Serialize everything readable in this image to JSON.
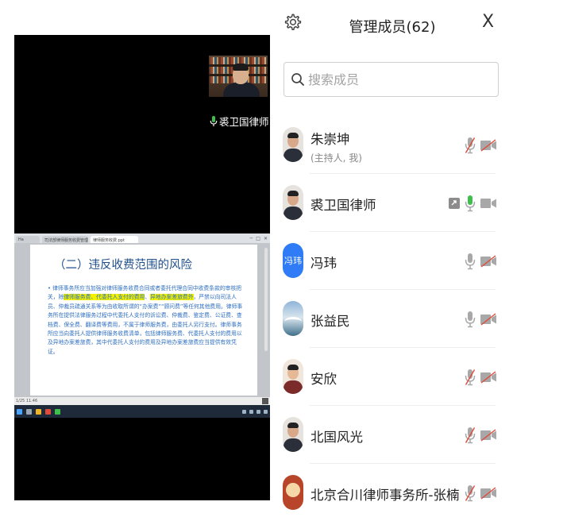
{
  "video": {
    "speaker_label": "裘卫国律师"
  },
  "shared_screen": {
    "browser_tabs": [
      "Ha",
      "司法部律师服务收费管理办法.ppt",
      "律师服务收费.ppt"
    ],
    "slide_title": "（二）违反收费范围的风险",
    "slide_body": {
      "p1": "律师事务所应当加强对律师服务收费合同或者委托代理合同中收费条款的审核把关，除",
      "h1": "律师服务费、代委托人支付的费用",
      "p2": "、",
      "h2": "异地办案差旅费外",
      "p3": "，严禁以向司法人员、仲裁员疏通关系等为由收取所谓的“办案费”“顾问费”等任何其他费用。律师事务所在提供法律服务过程中代委托人支付的诉讼费、仲裁费、鉴定费、公证费、查档费、保全费、翻译费等费用，不属于律师服务费，由委托人另行支付。律师事务所应当向委托人提供律师服务收费清单，包括律师服务费、代委托人支付的费用以及异地办案差旅费，其中代委托人支付的费用及异地办案差旅费应当提供有效凭证。"
    },
    "status_text": "1/25  11.46"
  },
  "panel": {
    "title": "管理成员(62)",
    "close_label": "X",
    "search_placeholder": "搜索成员"
  },
  "members": [
    {
      "name": "朱崇坤",
      "sub": "(主持人, 我)",
      "avatar": "photo"
    },
    {
      "name": "裘卫国律师",
      "sub": "",
      "avatar": "photo"
    },
    {
      "name": "冯玮",
      "sub": "",
      "avatar": "text",
      "avatar_text": "冯玮"
    },
    {
      "name": "张益民",
      "sub": "",
      "avatar": "nature"
    },
    {
      "name": "安欣",
      "sub": "",
      "avatar": "wine"
    },
    {
      "name": "北国风光",
      "sub": "",
      "avatar": "photo"
    },
    {
      "name": "北京合川律师事务所-张楠",
      "sub": "",
      "avatar": "logo"
    }
  ],
  "colors": {
    "mic_active": "#3dbf4a",
    "mic_muted_slash": "#e04a3a",
    "accent": "#2f7cf6"
  }
}
